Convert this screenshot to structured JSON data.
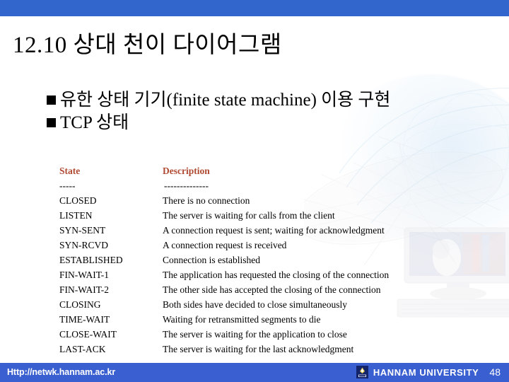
{
  "slide": {
    "title": "12.10 상대 천이 다이어그램",
    "accent_top_bar_color": "#3366CC",
    "footer_bar_color": "#3A5FD0",
    "table_header_color": "#B04A32"
  },
  "bullets": [
    {
      "marker": "square-bullet",
      "text": "유한 상태 기기(finite state machine) 이용 구현"
    },
    {
      "marker": "square-bullet",
      "text": "TCP 상태"
    }
  ],
  "state_table": {
    "headers": {
      "state": "State",
      "description": "Description"
    },
    "rule": {
      "state": "-----",
      "description": "--------------"
    },
    "rows": [
      {
        "state": "CLOSED",
        "description": "There is no connection"
      },
      {
        "state": "LISTEN",
        "description": "The server is waiting for calls from the client"
      },
      {
        "state": "SYN-SENT",
        "description": "A connection request is sent; waiting for acknowledgment"
      },
      {
        "state": "SYN-RCVD",
        "description": "A connection request is received"
      },
      {
        "state": "ESTABLISHED",
        "description": "Connection is established"
      },
      {
        "state": "FIN-WAIT-1",
        "description": "The application has requested the closing of the connection"
      },
      {
        "state": "FIN-WAIT-2",
        "description": "The other side has accepted the closing of the connection"
      },
      {
        "state": "CLOSING",
        "description": "Both sides have decided to close simultaneously"
      },
      {
        "state": "TIME-WAIT",
        "description": "Waiting for retransmitted segments to die"
      },
      {
        "state": "CLOSE-WAIT",
        "description": "The server is waiting for the application to close"
      },
      {
        "state": "LAST-ACK",
        "description": "The server is waiting for the last acknowledgment"
      }
    ]
  },
  "footer": {
    "url": "Http://netwk.hannam.ac.kr",
    "logo_icon": "hannam-university-crest-icon",
    "university": "HANNAM UNIVERSITY",
    "page_number": "48"
  }
}
